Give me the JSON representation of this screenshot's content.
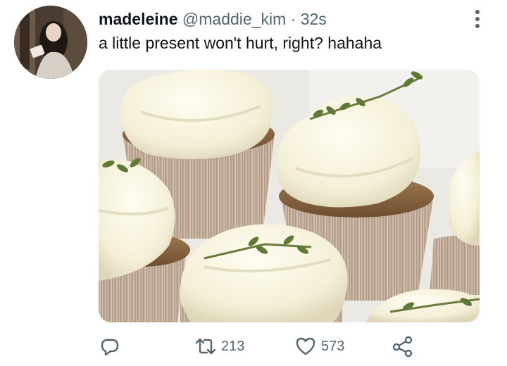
{
  "tweet": {
    "display_name": "madeleine",
    "handle": "@maddie_kim",
    "separator": "·",
    "timestamp": "32s",
    "text": "a little present won't hurt, right? hahaha",
    "avatar_icon": "profile-photo",
    "media_description_icon": "photo",
    "actions": {
      "reply_icon": "reply-icon",
      "retweet_icon": "retweet-icon",
      "retweet_count": "213",
      "like_icon": "heart-icon",
      "like_count": "573",
      "share_icon": "share-icon"
    },
    "more_icon": "more-vertical-icon"
  },
  "colors": {
    "text_primary": "#0f1419",
    "text_secondary": "#536471"
  }
}
